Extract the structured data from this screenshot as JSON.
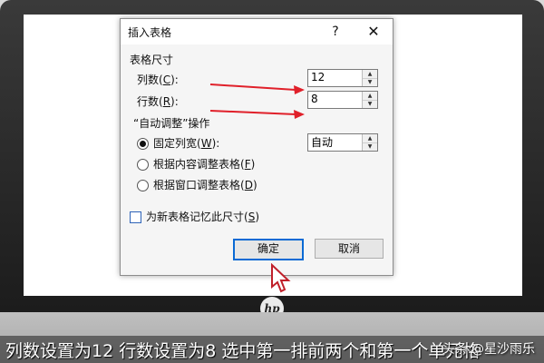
{
  "dialog": {
    "title": "插入表格",
    "help_label": "?",
    "close_label": "✕",
    "size_group": {
      "title": "表格尺寸",
      "columns_label": "列数(",
      "columns_key": "C",
      "columns_close": "):",
      "columns_value": "12",
      "rows_label": "行数(",
      "rows_key": "R",
      "rows_close": "):",
      "rows_value": "8"
    },
    "autofit_group": {
      "title": "“自动调整”操作",
      "fixed_label": "固定列宽(",
      "fixed_key": "W",
      "fixed_close": "):",
      "fixed_value": "自动",
      "content_label": "根据内容调整表格(",
      "content_key": "F",
      "content_close": ")",
      "window_label": "根据窗口调整表格(",
      "window_key": "D",
      "window_close": ")"
    },
    "remember_label": "为新表格记忆此尺寸(",
    "remember_key": "S",
    "remember_close": ")",
    "ok_label": "确定",
    "cancel_label": "取消"
  },
  "spinner_glyphs": {
    "up": "▲",
    "down": "▼"
  },
  "laptop": {
    "logo": "hp"
  },
  "caption": {
    "text": "列数设置为12 行数设置为8 选中第一排前两个和第一个单元格"
  },
  "watermark": {
    "text": "头条 @星沙雨乐"
  },
  "colors": {
    "arrow": "#e0202a",
    "accent": "#0a6ad4"
  }
}
